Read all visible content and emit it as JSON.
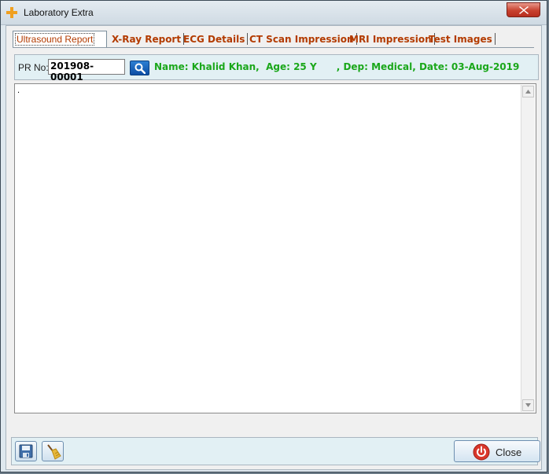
{
  "window": {
    "title": "Laboratory Extra"
  },
  "tabs": [
    {
      "label": "Ultrasound Report",
      "active": true
    },
    {
      "label": "X-Ray Report"
    },
    {
      "label": "ECG Details"
    },
    {
      "label": "CT Scan Impression"
    },
    {
      "label": "MRI Impression"
    },
    {
      "label": "Test Images"
    }
  ],
  "pr": {
    "label": "PR No:",
    "value": "201908-00001",
    "patient_info": "Name: Khalid Khan,  Age: 25 Y      , Dep: Medical, Date: 03-Aug-2019"
  },
  "editor": {
    "content": "."
  },
  "footer": {
    "close_label": "Close"
  },
  "icons": {
    "app": "plus-icon",
    "search": "search-icon",
    "save": "save-icon",
    "clear": "broom-icon",
    "close": "power-icon"
  },
  "colors": {
    "tab_text": "#b33b00",
    "patient_info": "#1aa71a",
    "close_x": "#c8422f"
  }
}
